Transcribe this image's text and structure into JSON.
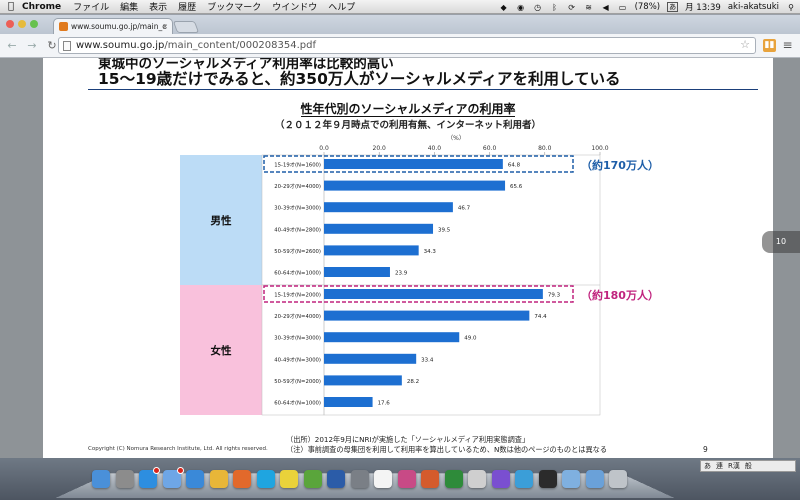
{
  "menubar": {
    "app": "Chrome",
    "items": [
      "ファイル",
      "編集",
      "表示",
      "履歴",
      "ブックマーク",
      "ウインドウ",
      "ヘルプ"
    ],
    "battery": "(78%)",
    "ime": "あ",
    "clock": "月 13:39",
    "user": "aki-akatsuki"
  },
  "browser": {
    "tab_title": "www.soumu.go.jp/main_c",
    "url_host": "www.soumu.go.jp",
    "url_path": "/main_content/000208354.pdf"
  },
  "pdf": {
    "page_indicator": "10",
    "heading_top": "東城中のソーシャルメディア利用率は比較的高い",
    "heading_main": "15～19歳だけでみると、約350万人がソーシャルメディアを利用している",
    "footer_copyright": "Copyright (C) Nomura Research Institute, Ltd. All rights reserved.",
    "footer_source": "（出所）2012年9月にNRIが実施した「ソーシャルメディア利用実態調査」",
    "footer_note": "（注）事前調査の母集団を利用して利用率を算出しているため、N数は他のページのものとは異なる",
    "page_number": "9"
  },
  "chart_data": {
    "type": "bar",
    "orientation": "horizontal",
    "title": "性年代別のソーシャルメディアの利用率",
    "subtitle": "（２０１２年９月時点での利用有無、インターネット利用者）",
    "unit_label": "（%）",
    "xlim": [
      0,
      100
    ],
    "xticks": [
      "0.0",
      "20.0",
      "40.0",
      "60.0",
      "80.0",
      "100.0"
    ],
    "groups": [
      {
        "name": "男性",
        "color": "#bcdcf6",
        "categories": [
          "15-19才(N=1600)",
          "20-29才(N=4000)",
          "30-39才(N=3000)",
          "40-49才(N=2800)",
          "50-59才(N=2600)",
          "60-64才(N=1000)"
        ],
        "values": [
          64.8,
          65.6,
          46.7,
          39.5,
          34.3,
          23.9
        ],
        "callout": "（約170万人）",
        "callout_color": "#1e5ea8"
      },
      {
        "name": "女性",
        "color": "#f9c1dc",
        "categories": [
          "15-19才(N=2000)",
          "20-29才(N=4000)",
          "30-39才(N=3000)",
          "40-49才(N=3000)",
          "50-59才(N=2000)",
          "60-64才(N=1000)"
        ],
        "values": [
          79.3,
          74.4,
          49.0,
          33.4,
          28.2,
          17.6
        ],
        "callout": "（約180万人）",
        "callout_color": "#c0237e"
      }
    ],
    "bar_color": "#1d6fd1"
  }
}
